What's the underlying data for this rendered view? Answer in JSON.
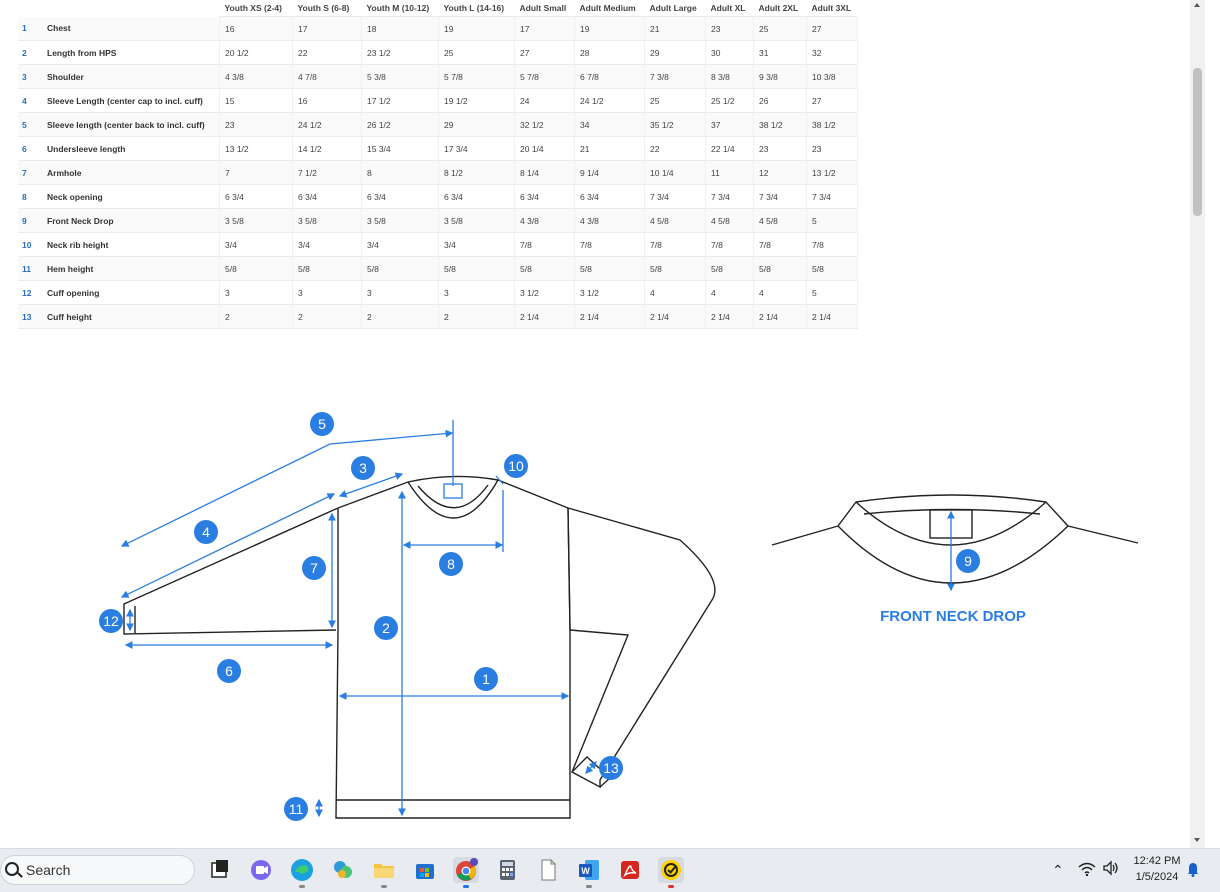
{
  "table": {
    "columns": [
      "Youth XS (2-4)",
      "Youth S (6-8)",
      "Youth M (10-12)",
      "Youth L (14-16)",
      "Adult Small",
      "Adult Medium",
      "Adult Large",
      "Adult XL",
      "Adult 2XL",
      "Adult 3XL"
    ],
    "rows": [
      {
        "idx": "1",
        "label": "Chest",
        "values": [
          "16",
          "17",
          "18",
          "19",
          "17",
          "19",
          "21",
          "23",
          "25",
          "27"
        ]
      },
      {
        "idx": "2",
        "label": "Length from HPS",
        "values": [
          "20 1/2",
          "22",
          "23 1/2",
          "25",
          "27",
          "28",
          "29",
          "30",
          "31",
          "32"
        ]
      },
      {
        "idx": "3",
        "label": "Shoulder",
        "values": [
          "4 3/8",
          "4 7/8",
          "5 3/8",
          "5 7/8",
          "5 7/8",
          "6 7/8",
          "7 3/8",
          "8 3/8",
          "9 3/8",
          "10 3/8"
        ]
      },
      {
        "idx": "4",
        "label": "Sleeve Length (center cap to incl. cuff)",
        "values": [
          "15",
          "16",
          "17 1/2",
          "19 1/2",
          "24",
          "24 1/2",
          "25",
          "25 1/2",
          "26",
          "27"
        ]
      },
      {
        "idx": "5",
        "label": "Sleeve length (center back to incl. cuff)",
        "values": [
          "23",
          "24 1/2",
          "26 1/2",
          "29",
          "32 1/2",
          "34",
          "35 1/2",
          "37",
          "38 1/2",
          "38 1/2"
        ]
      },
      {
        "idx": "6",
        "label": "Undersleeve length",
        "values": [
          "13 1/2",
          "14 1/2",
          "15 3/4",
          "17 3/4",
          "20 1/4",
          "21",
          "22",
          "22 1/4",
          "23",
          "23"
        ]
      },
      {
        "idx": "7",
        "label": "Armhole",
        "values": [
          "7",
          "7 1/2",
          "8",
          "8 1/2",
          "8 1/4",
          "9 1/4",
          "10 1/4",
          "11",
          "12",
          "13 1/2"
        ]
      },
      {
        "idx": "8",
        "label": "Neck opening",
        "values": [
          "6 3/4",
          "6 3/4",
          "6 3/4",
          "6 3/4",
          "6 3/4",
          "6 3/4",
          "7 3/4",
          "7 3/4",
          "7 3/4",
          "7 3/4"
        ]
      },
      {
        "idx": "9",
        "label": "Front Neck Drop",
        "values": [
          "3 5/8",
          "3 5/8",
          "3 5/8",
          "3 5/8",
          "4 3/8",
          "4 3/8",
          "4 5/8",
          "4 5/8",
          "4 5/8",
          "5"
        ]
      },
      {
        "idx": "10",
        "label": "Neck rib height",
        "values": [
          "3/4",
          "3/4",
          "3/4",
          "3/4",
          "7/8",
          "7/8",
          "7/8",
          "7/8",
          "7/8",
          "7/8"
        ]
      },
      {
        "idx": "11",
        "label": "Hem height",
        "values": [
          "5/8",
          "5/8",
          "5/8",
          "5/8",
          "5/8",
          "5/8",
          "5/8",
          "5/8",
          "5/8",
          "5/8"
        ]
      },
      {
        "idx": "12",
        "label": "Cuff opening",
        "values": [
          "3",
          "3",
          "3",
          "3",
          "3 1/2",
          "3 1/2",
          "4",
          "4",
          "4",
          "5"
        ]
      },
      {
        "idx": "13",
        "label": "Cuff height",
        "values": [
          "2",
          "2",
          "2",
          "2",
          "2 1/4",
          "2 1/4",
          "2 1/4",
          "2 1/4",
          "2 1/4",
          "2 1/4"
        ]
      }
    ]
  },
  "diagram": {
    "badges": [
      "1",
      "2",
      "3",
      "4",
      "5",
      "6",
      "7",
      "8",
      "9",
      "10",
      "11",
      "12",
      "13"
    ],
    "neck_drop_title": "FRONT NECK DROP",
    "accent_color": "#2a7de1",
    "line_color": "#2a7de1",
    "outline_color": "#222222"
  },
  "taskbar": {
    "search_placeholder": "Search",
    "apps": [
      "task-view-icon",
      "teams-chat-icon",
      "edge-browser-icon",
      "widgets-icon",
      "file-explorer-icon",
      "microsoft-store-icon",
      "chrome-browser-icon",
      "calculator-icon",
      "notepad-icon",
      "word-icon",
      "acrobat-icon",
      "norton-icon"
    ],
    "time": "12:42 PM",
    "date": "1/5/2024"
  }
}
